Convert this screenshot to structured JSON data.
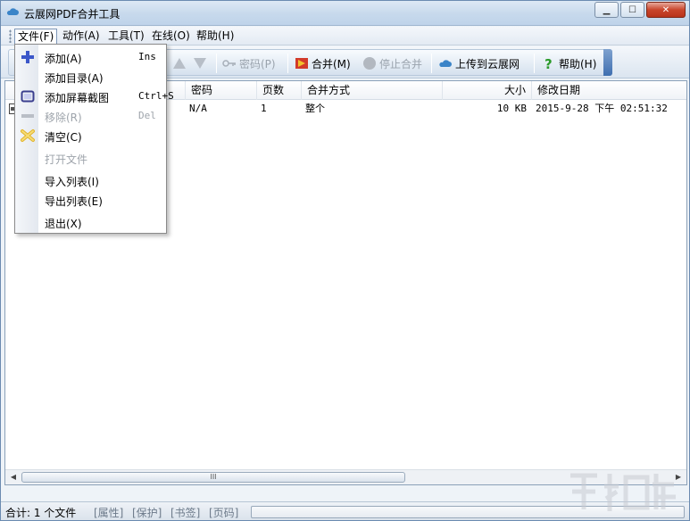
{
  "window": {
    "title": "云展网PDF合并工具",
    "controls": {
      "minimize": "▁",
      "maximize": "☐",
      "close": "✕"
    }
  },
  "menubar": {
    "items": [
      {
        "label": "文件(F)"
      },
      {
        "label": "动作(A)"
      },
      {
        "label": "工具(T)"
      },
      {
        "label": "在线(O)"
      },
      {
        "label": "帮助(H)"
      }
    ]
  },
  "file_menu": {
    "items": [
      {
        "label": "添加(A)",
        "shortcut": "Ins",
        "icon": "plus-icon",
        "enabled": true
      },
      {
        "label": "添加目录(A)",
        "shortcut": "",
        "icon": "",
        "enabled": true
      },
      {
        "label": "添加屏幕截图",
        "shortcut": "Ctrl+S",
        "icon": "screenshot-icon",
        "enabled": true
      },
      {
        "label": "移除(R)",
        "shortcut": "Del",
        "icon": "minus-icon",
        "enabled": false
      },
      {
        "label": "清空(C)",
        "shortcut": "",
        "icon": "clear-icon",
        "enabled": true
      },
      {
        "label": "打开文件",
        "shortcut": "",
        "icon": "",
        "enabled": false
      },
      {
        "label": "导入列表(I)",
        "shortcut": "",
        "icon": "",
        "enabled": true
      },
      {
        "label": "导出列表(E)",
        "shortcut": "",
        "icon": "",
        "enabled": true
      },
      {
        "label": "退出(X)",
        "shortcut": "",
        "icon": "",
        "enabled": true
      }
    ]
  },
  "toolbar": {
    "password": "密码(P)",
    "merge": "合并(M)",
    "stop_merge": "停止合并",
    "upload": "上传到云展网",
    "help": "帮助(H)"
  },
  "list": {
    "columns": [
      "密码",
      "页数",
      "合并方式",
      "大小",
      "修改日期"
    ],
    "rows": [
      {
        "password": "N/A",
        "pages": "1",
        "mode": "整个",
        "size": "10 KB",
        "modified": "2015-9-28 下午 02:51:32"
      }
    ],
    "scroll_grip": "III"
  },
  "statusbar": {
    "total": "合计: 1 个文件",
    "properties": "[属性]",
    "protect": "[保护]",
    "bookmark": "[书签]",
    "page_number": "[页码]"
  },
  "colors": {
    "accent": "#3f6fb0",
    "merge_red": "#d23a2a",
    "help_green": "#2a9a2a",
    "cloud_blue": "#3a84c8"
  }
}
